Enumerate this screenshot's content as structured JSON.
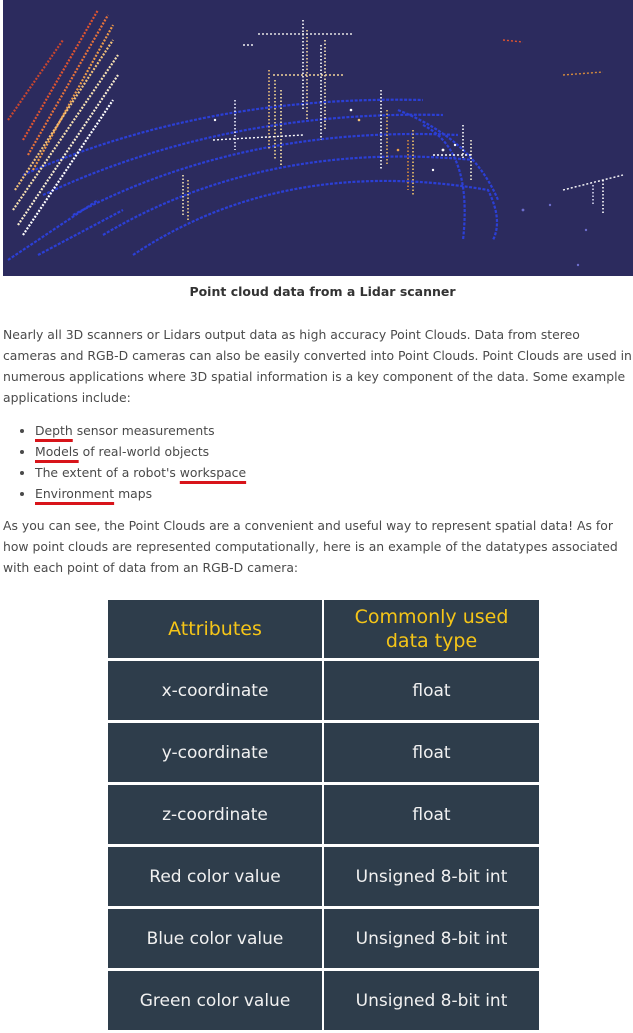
{
  "figure": {
    "caption": "Point cloud data from a Lidar scanner",
    "background_color": "#2c2b5e"
  },
  "intro_paragraph": "Nearly all 3D scanners or Lidars output data as high accuracy Point Clouds. Data from stereo cameras and RGB-D cameras can also be easily converted into Point Clouds. Point Clouds are used in numerous applications where 3D spatial information is a key component of the data. Some example applications include:",
  "applications": [
    {
      "underlined": "Depth",
      "rest": " sensor measurements"
    },
    {
      "underlined": "Models",
      "rest": " of real-world objects"
    },
    {
      "prefix": "The extent of a robot's ",
      "underlined": "workspace"
    },
    {
      "underlined": "Environment",
      "rest": " maps"
    }
  ],
  "second_paragraph": "As you can see, the Point Clouds are a convenient and useful way to represent spatial data! As for how point clouds are represented computationally, here is an example of the datatypes associated with each point of data from an RGB-D camera:",
  "table": {
    "header": {
      "attributes": "Attributes",
      "type": "Commonly used data type"
    },
    "rows": [
      {
        "attribute": "x-coordinate",
        "type": "float"
      },
      {
        "attribute": "y-coordinate",
        "type": "float"
      },
      {
        "attribute": "z-coordinate",
        "type": "float"
      },
      {
        "attribute": "Red color value",
        "type": "Unsigned 8-bit int"
      },
      {
        "attribute": "Blue color value",
        "type": "Unsigned 8-bit int"
      },
      {
        "attribute": "Green color value",
        "type": "Unsigned 8-bit int"
      }
    ],
    "header_text_color": "#f5c518",
    "cell_color": "#2e3d4b"
  },
  "annotation_color": "#d8141a"
}
